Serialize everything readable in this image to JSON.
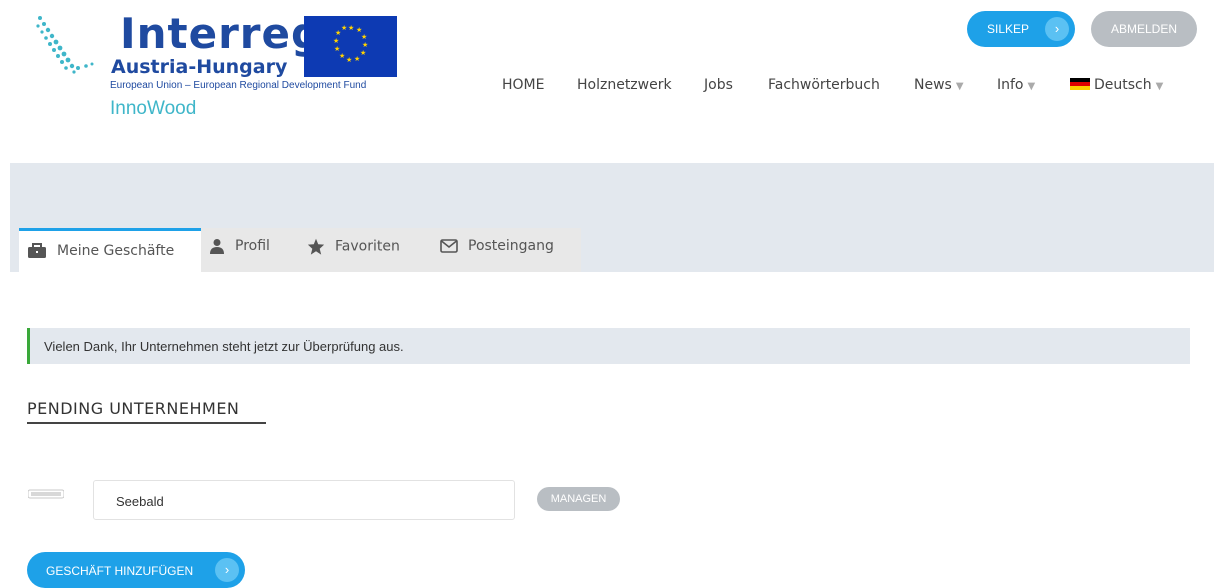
{
  "header": {
    "logo": {
      "title": "Interreg",
      "subtitle": "Austria-Hungary",
      "fund": "European Union – European Regional Development Fund",
      "project": "InnoWood"
    },
    "user_button": "SILKEP",
    "logout_button": "ABMELDEN"
  },
  "nav": {
    "items": [
      "HOME",
      "Holznetzwerk",
      "Jobs",
      "Fachwörterbuch",
      "News",
      "Info",
      "Deutsch"
    ]
  },
  "tabs": [
    {
      "label": "Meine Geschäfte",
      "icon": "briefcase-icon",
      "active": true
    },
    {
      "label": "Profil",
      "icon": "user-icon",
      "active": false
    },
    {
      "label": "Favoriten",
      "icon": "star-icon",
      "active": false
    },
    {
      "label": "Posteingang",
      "icon": "envelope-icon",
      "active": false
    }
  ],
  "notice": {
    "text": "Vielen Dank, Ihr Unternehmen steht jetzt zur Überprüfung aus."
  },
  "section": {
    "title": "PENDING UNTERNEHMEN"
  },
  "business": {
    "name": "Seebald",
    "manage_button": "MANAGEN"
  },
  "add_button": "GESCHÄFT HINZUFÜGEN",
  "colors": {
    "primary": "#1ea1e8",
    "muted_button": "#b9bec3",
    "banner_bg": "#e3e8ee",
    "notice_border": "#3aa83a",
    "logo_blue": "#1f4aa0",
    "logo_teal": "#3fb6c9"
  }
}
